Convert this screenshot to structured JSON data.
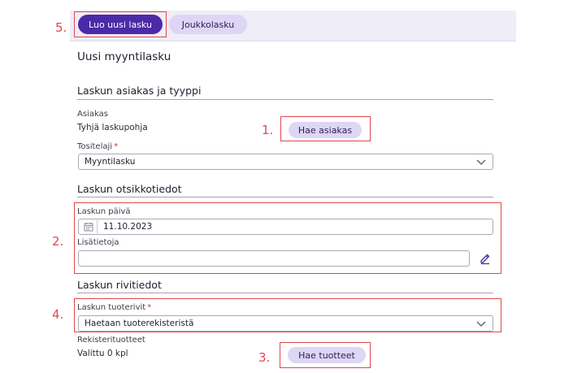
{
  "toolbar": {
    "create_invoice_label": "Luo uusi lasku",
    "batch_invoice_label": "Joukkolasku"
  },
  "page": {
    "title": "Uusi myyntilasku"
  },
  "customer_section": {
    "heading": "Laskun asiakas ja tyyppi",
    "customer_label": "Asiakas",
    "customer_value": "Tyhjä laskupohja",
    "fetch_customer_label": "Hae asiakas",
    "doc_type_label": "Tositelaji",
    "required_mark": "*",
    "doc_type_value": "Myyntilasku"
  },
  "header_section": {
    "heading": "Laskun otsikkotiedot",
    "date_label": "Laskun päivä",
    "date_value": "11.10.2023",
    "extra_info_label": "Lisätietoja",
    "extra_info_value": ""
  },
  "rows_section": {
    "heading": "Laskun rivitiedot",
    "product_rows_label": "Laskun tuoterivit",
    "required_mark": "*",
    "product_rows_value": "Haetaan tuoterekisteristä",
    "registry_products_label": "Rekisterituotteet",
    "selected_count": "Valittu 0 kpl",
    "fetch_products_label": "Hae tuotteet"
  },
  "annotations": {
    "step_1": "1.",
    "step_2": "2.",
    "step_3": "3.",
    "step_4": "4.",
    "step_5": "5.",
    "color": "#e0484f"
  },
  "icons": {
    "dropdown": "chevron-down-icon",
    "calendar": "calendar-icon",
    "edit": "pencil-icon"
  },
  "colors": {
    "primary": "#4b2aa8",
    "secondary_pill": "#ddd6f4",
    "topbar": "#efedf8"
  }
}
